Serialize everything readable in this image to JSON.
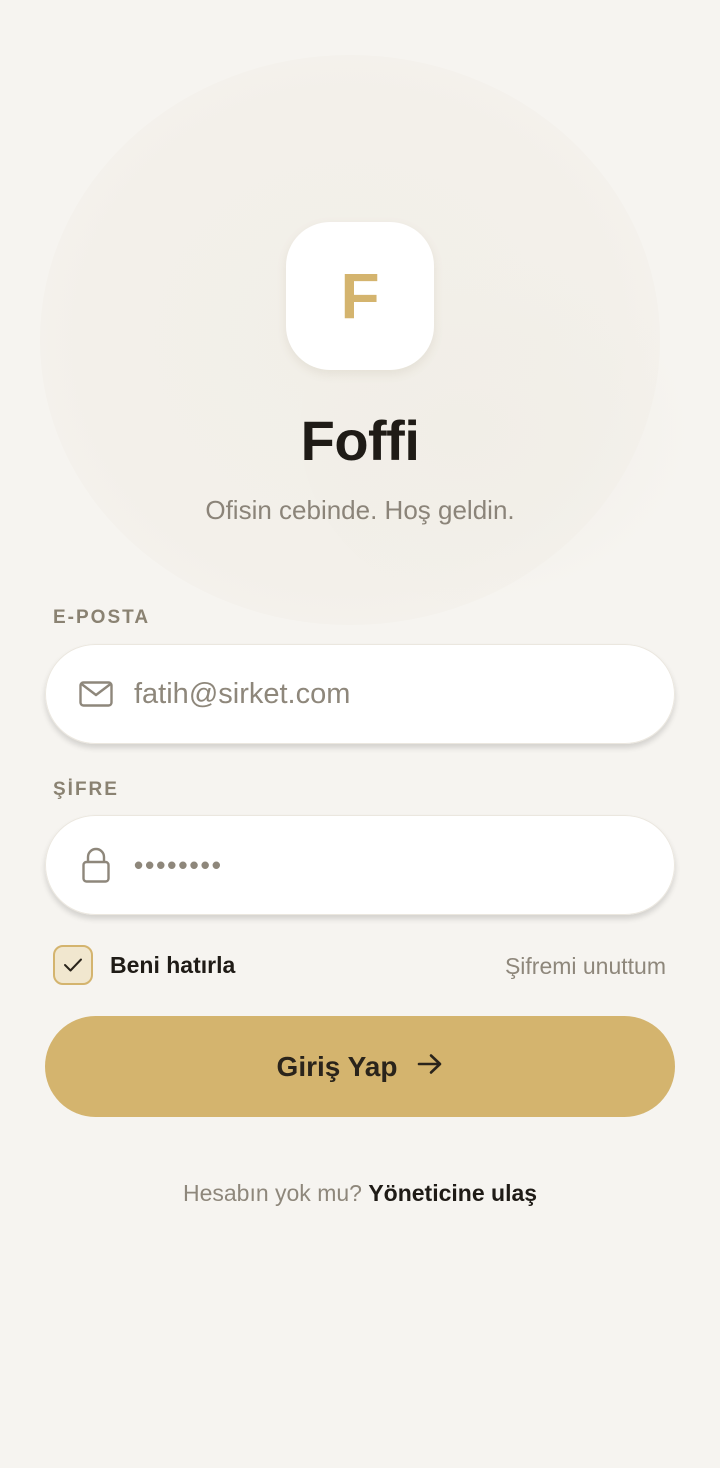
{
  "app": {
    "logo_letter": "F",
    "name": "Foffi",
    "tagline": "Ofisin cebinde. Hoş geldin."
  },
  "form": {
    "email": {
      "label": "E-POSTA",
      "value": "fatih@sirket.com",
      "icon": "mail-icon"
    },
    "password": {
      "label": "ŞİFRE",
      "value": "••••••••",
      "icon": "lock-icon"
    },
    "remember_me": {
      "label": "Beni hatırla",
      "checked": true
    },
    "forgot_password": "Şifremi unuttum",
    "submit": {
      "label": "Giriş Yap",
      "icon": "arrow-right-icon"
    }
  },
  "footer": {
    "prompt": "Hesabın yok mu?",
    "link": "Yöneticine ulaş"
  },
  "colors": {
    "background": "#f6f4f0",
    "accent": "#d4b46e",
    "text_primary": "#1f1b16",
    "text_muted": "#8e877b"
  }
}
